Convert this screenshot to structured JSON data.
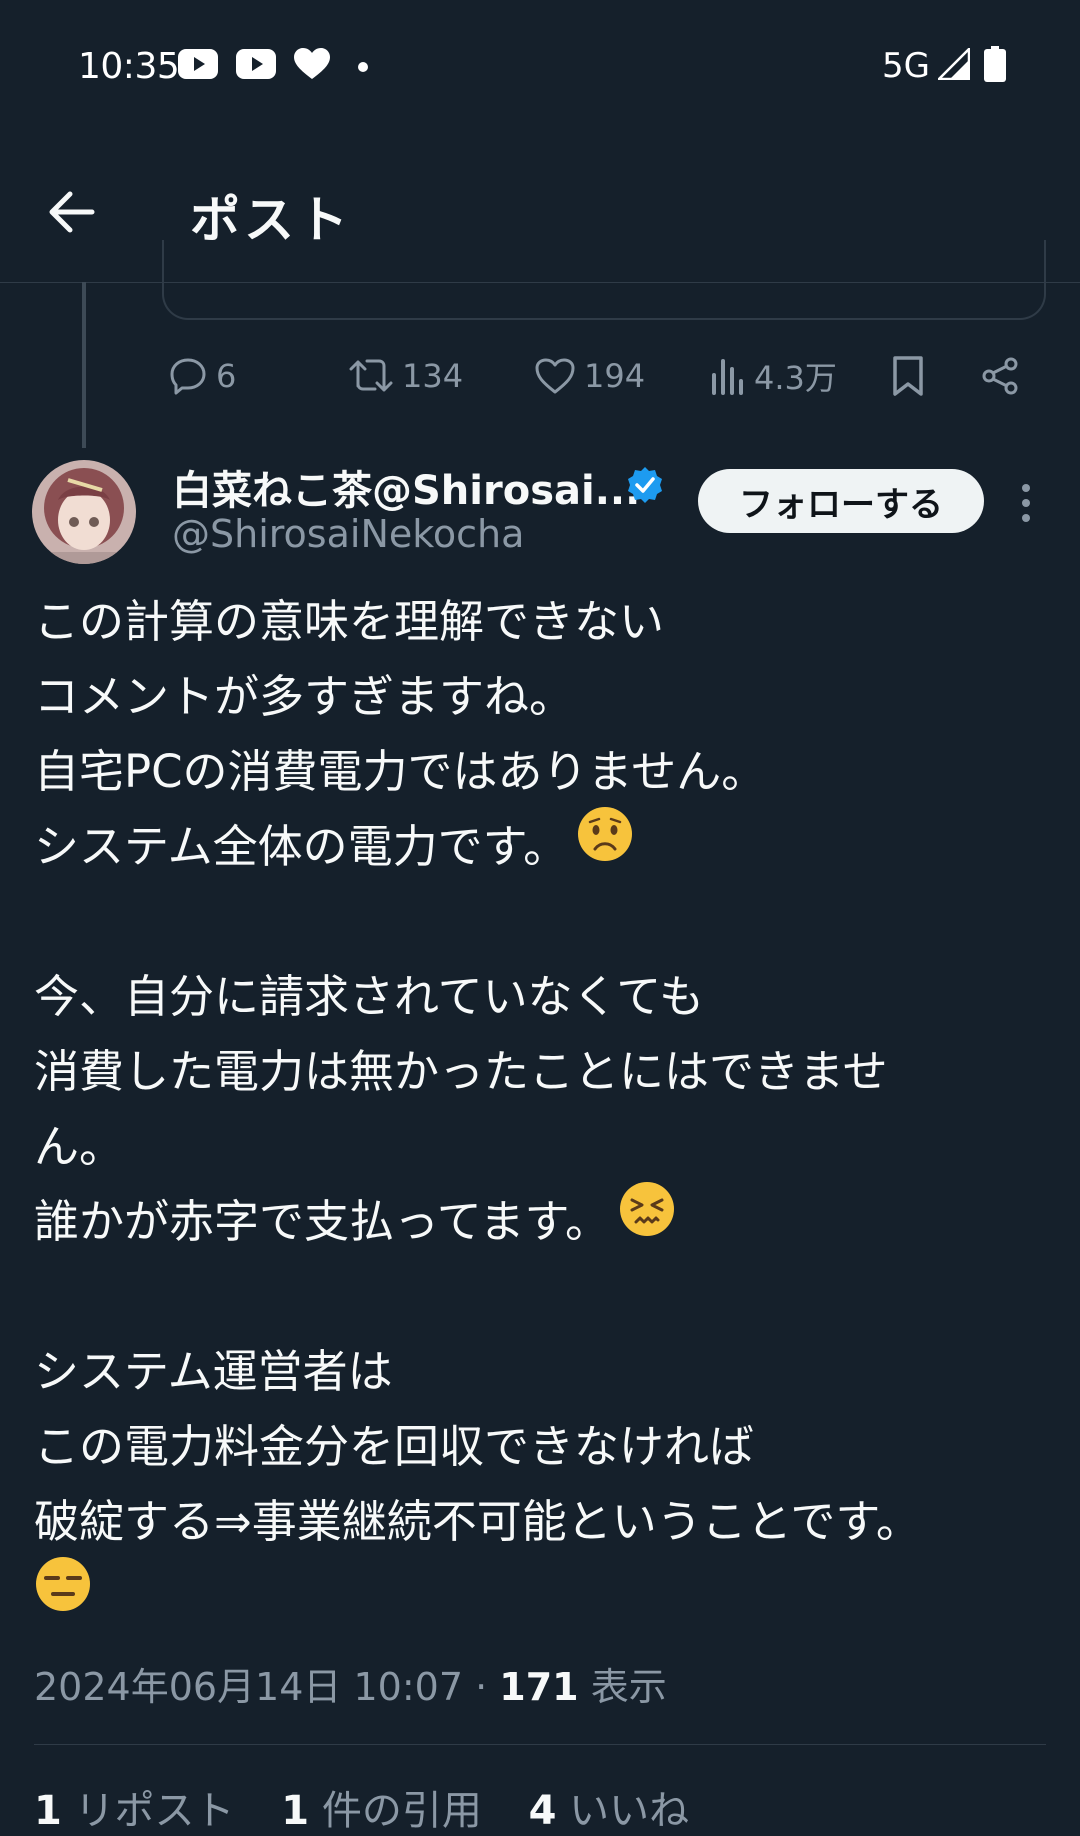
{
  "status_bar": {
    "time": "10:35",
    "network": "5G",
    "icons": [
      "youtube-icon",
      "youtube-icon",
      "heart-icon",
      "dot-icon",
      "signal-icon",
      "battery-icon"
    ]
  },
  "header": {
    "title": "ポスト",
    "back_icon": "arrow-left-icon"
  },
  "parent_post_actions": {
    "replies": "6",
    "reposts": "134",
    "likes": "194",
    "views": "4.3万"
  },
  "post": {
    "display_name": "白菜ねこ茶@Shirosai...",
    "handle": "@ShirosaiNekocha",
    "verified": true,
    "follow_label": "フォローする",
    "lines": {
      "l1": "この計算の意味を理解できない",
      "l2": "コメントが多すぎますね。",
      "l3": "自宅PCの消費電力ではありません。",
      "l4": "システム全体の電力です。",
      "l5": "今、自分に請求されていなくても",
      "l6": "消費した電力は無かったことにはできませ",
      "l7": "ん。",
      "l8": "誰かが赤字で支払ってます。",
      "l9": "システム運営者は",
      "l10": "この電力料金分を回収できなければ",
      "l11": "破綻する⇒事業継続不可能ということです。"
    },
    "timestamp": "2024年06月14日 10:07",
    "separator": "·",
    "view_count": "171",
    "view_label": "表示"
  },
  "stats": {
    "reposts_count": "1",
    "reposts_label": "リポスト",
    "quotes_count": "1",
    "quotes_label": "件の引用",
    "likes_count": "4",
    "likes_label": "いいね"
  },
  "colors": {
    "background": "#15202b",
    "text": "#f7f9f9",
    "secondary": "#8b98a5",
    "verified": "#1d9bf0",
    "follow_bg": "#eff3f4"
  }
}
